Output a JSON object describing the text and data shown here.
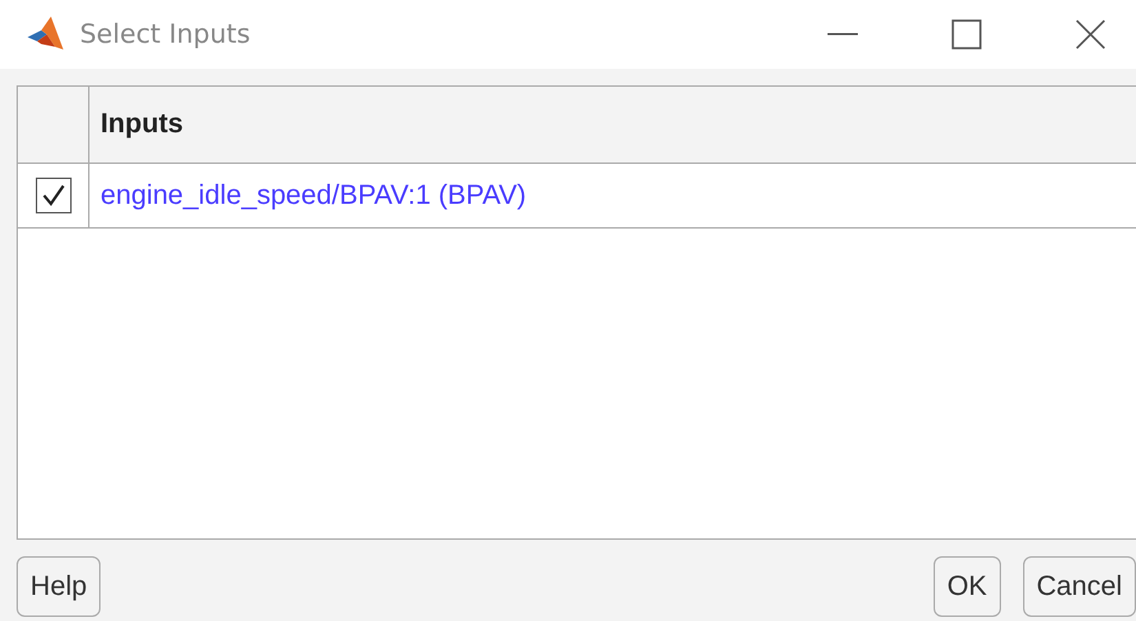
{
  "window": {
    "title": "Select Inputs"
  },
  "table": {
    "columns": [
      "Inputs"
    ],
    "rows": [
      {
        "checked": true,
        "input": "engine_idle_speed/BPAV:1 (BPAV)"
      }
    ]
  },
  "buttons": [
    {
      "label": "Help",
      "kind": "left"
    },
    {
      "label": "OK",
      "kind": "right"
    },
    {
      "label": "Cancel",
      "kind": "right"
    }
  ]
}
